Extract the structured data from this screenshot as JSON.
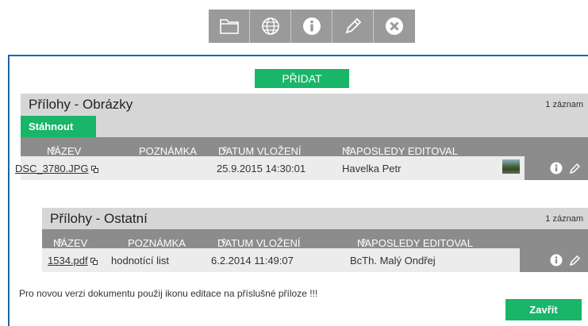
{
  "toolbar": {
    "buttons": [
      {
        "icon": "folder-icon"
      },
      {
        "icon": "globe-icon"
      },
      {
        "icon": "info-icon"
      },
      {
        "icon": "pencil-icon"
      },
      {
        "icon": "close-icon"
      }
    ]
  },
  "dialog": {
    "add_label": "PŘIDAT",
    "images": {
      "title": "Přílohy - Obrázky",
      "count": "1 záznam",
      "download_label": "Stáhnout",
      "columns": {
        "name": "NÁZEV",
        "note": "POZNÁMKA",
        "date": "DATUM VLOŽENÍ",
        "editor": "NAPOSLEDY EDITOVAL"
      },
      "sort_glyph": "≎",
      "rows": [
        {
          "name": "DSC_3780.JPG",
          "note": "",
          "date": "25.9.2015 14:30:01",
          "editor": "Havelka Petr"
        }
      ]
    },
    "other": {
      "title": "Přílohy - Ostatní",
      "count": "1 záznam",
      "columns": {
        "name": "NÁZEV",
        "note": "POZNÁMKA",
        "date": "DATUM VLOŽENÍ",
        "editor": "NAPOSLEDY EDITOVAL"
      },
      "sort_glyph": "≎",
      "rows": [
        {
          "name": "1534.pdf",
          "note": "hodnotící list",
          "date": "6.2.2014 11:49:07",
          "editor": "BcTh. Malý Ondřej"
        }
      ]
    },
    "note_text": "Pro novou verzi dokumentu použij ikonu editace na příslušné příloze !!!",
    "close_label": "Zavřít"
  },
  "colors": {
    "accent_green": "#19b569",
    "header_gray": "#8c8c8c",
    "section_gray": "#d6d6d6",
    "border_blue": "#1f64a8",
    "toolbar_gray": "#9a9a9a"
  }
}
